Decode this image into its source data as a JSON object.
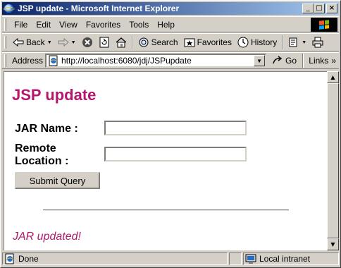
{
  "window": {
    "title": "JSP update - Microsoft Internet Explorer",
    "minimize_glyph": "_",
    "maximize_glyph": "□",
    "close_glyph": "×"
  },
  "menubar": {
    "items": [
      "File",
      "Edit",
      "View",
      "Favorites",
      "Tools",
      "Help"
    ]
  },
  "toolbar": {
    "back": "Back",
    "search": "Search",
    "favorites": "Favorites",
    "history": "History"
  },
  "addressbar": {
    "label": "Address",
    "url": "http://localhost:6080/jdj/JSPupdate",
    "go": "Go",
    "links": "Links",
    "links_glyph": "»"
  },
  "page": {
    "title": "JSP update",
    "jar_label": "JAR Name :",
    "jar_value": "",
    "location_label_1": "Remote",
    "location_label_2": "Location :",
    "location_value": "",
    "submit_label": "Submit Query",
    "result": "JAR updated!"
  },
  "statusbar": {
    "status": "Done",
    "zone": "Local intranet"
  },
  "colors": {
    "accent": "#b5176e",
    "titlebar_start": "#0a246a",
    "titlebar_end": "#a6caf0",
    "chrome": "#d4d0c8"
  }
}
